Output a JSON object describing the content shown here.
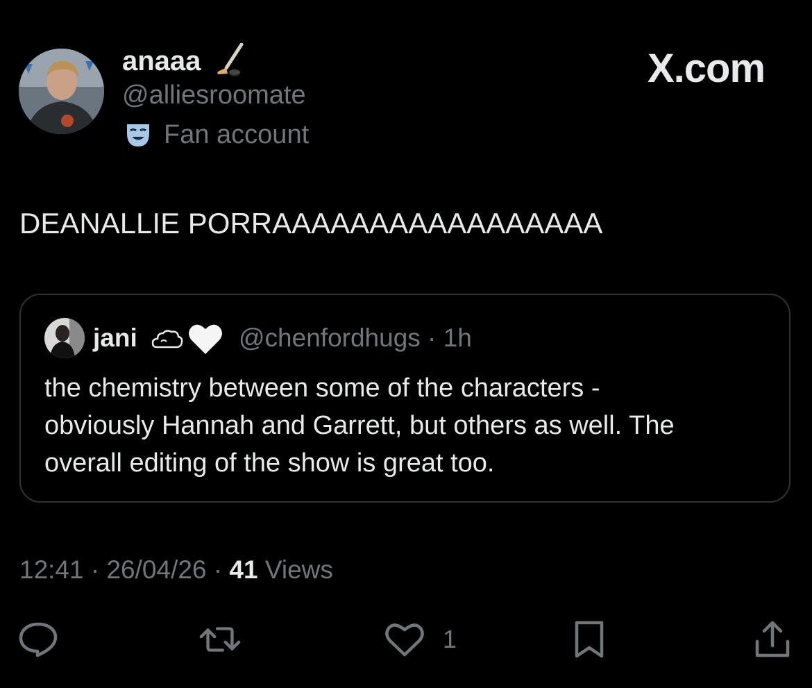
{
  "author": {
    "display_name": "anaaa",
    "name_emoji": "hockey-stick-icon",
    "handle": "@alliesroomate",
    "account_label": "Fan account",
    "label_icon": "theater-mask-icon"
  },
  "brand": {
    "text": "X.com"
  },
  "post": {
    "text": "DEANALLIE PORRAAAAAAAAAAAAAAAAA"
  },
  "quote": {
    "display_name": "jani",
    "name_emojis": [
      "cloud-icon",
      "white-heart-icon"
    ],
    "handle_time": "@chenfordhugs · 1h",
    "lines": [
      "the chemistry between some of the characters -",
      "obviously Hannah and Garrett, but others as well. The",
      "overall editing of the show is great too."
    ]
  },
  "meta": {
    "time": "12:41",
    "sep1": " · ",
    "date": "26/04/26",
    "sep2": " · ",
    "views_count": "41",
    "views_label": " Views"
  },
  "actions": {
    "reply_icon": "reply-icon",
    "repost_icon": "repost-icon",
    "like_icon": "heart-icon",
    "like_count": "1",
    "bookmark_icon": "bookmark-icon",
    "share_icon": "share-icon"
  },
  "colors": {
    "background": "#000000",
    "primary_text": "#e7e9ea",
    "secondary_text": "#71767b",
    "border": "#2f3336",
    "mask_accent": "#a8c8e8"
  }
}
